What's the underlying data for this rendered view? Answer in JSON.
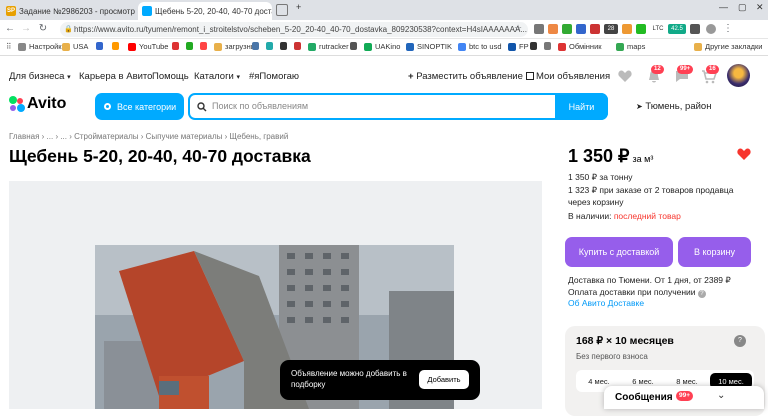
{
  "browser": {
    "tabs": [
      {
        "title": "Задание №2986203 - просмотр з",
        "favicon": "SP"
      },
      {
        "title": "Щебень 5-20, 20-40, 40-70 достав",
        "favicon": ""
      }
    ],
    "new_tab": "+",
    "url": "https://www.avito.ru/tyumen/remont_i_stroitelstvo/scheben_5-20_20-40_40-70_dostavka_809230538?context=H4sIAAAAAAA...",
    "bookmarks": [
      "Настройки",
      "USA",
      "YouTube",
      "загрузник",
      "rutracker",
      "UAKino",
      "SINOPTIK",
      "btc to usd",
      "FP",
      "Обмінник",
      "maps",
      "Другие закладки"
    ],
    "ext_labels": {
      "rate": "LTC",
      "count1": "28",
      "count2": "42.5"
    }
  },
  "topnav": {
    "items": [
      "Для бизнеса",
      "Карьера в Авито",
      "Помощь",
      "Каталоги",
      "#яПомогаю"
    ],
    "post_ad": "Разместить объявление",
    "my_ads": "Мои объявления",
    "badges": {
      "notifications": "12",
      "messages": "99+",
      "cart": "16"
    }
  },
  "header": {
    "logo": "Avito",
    "categories_button": "Все категории",
    "search_placeholder": "Поиск по объявлениям",
    "search_button": "Найти",
    "location": "Тюмень, район"
  },
  "breadcrumbs": "Главная › ... › ... › Стройматериалы › Сыпучие материалы › Щебень, гравий",
  "listing": {
    "title": "Щебень 5-20, 20-40, 40-70 доставка",
    "price": "1 350 ₽",
    "price_unit": "за м³",
    "price_per_ton": "1 350 ₽ за тонну",
    "bulk_price_line1": "1 323 ₽ при заказе от 2 товаров продавца",
    "bulk_price_line2": "через корзину",
    "stock_label": "В наличии:",
    "stock_value": "последний товар",
    "buy_button": "Купить с доставкой",
    "cart_button": "В корзину",
    "delivery_line1": "Доставка по Тюмени. От 1 дня, от 2389 ₽",
    "delivery_line2": "Оплата доставки при получении",
    "delivery_link": "Об Авито Доставке"
  },
  "installment": {
    "headline": "168 ₽ × 10 месяцев",
    "sub": "Без первого взноса",
    "help": "?",
    "options": [
      "4 мес.",
      "6 мес.",
      "8 мес.",
      "10 мес."
    ],
    "selected": "10 мес."
  },
  "toast": {
    "text": "Объявление можно добавить в подборку",
    "button": "Добавить"
  },
  "messages_widget": {
    "label": "Сообщения",
    "count": "99+"
  },
  "colors": {
    "accent": "#00aaff",
    "purple": "#965eeb",
    "red": "#f7352d",
    "badge": "#ff4053"
  }
}
